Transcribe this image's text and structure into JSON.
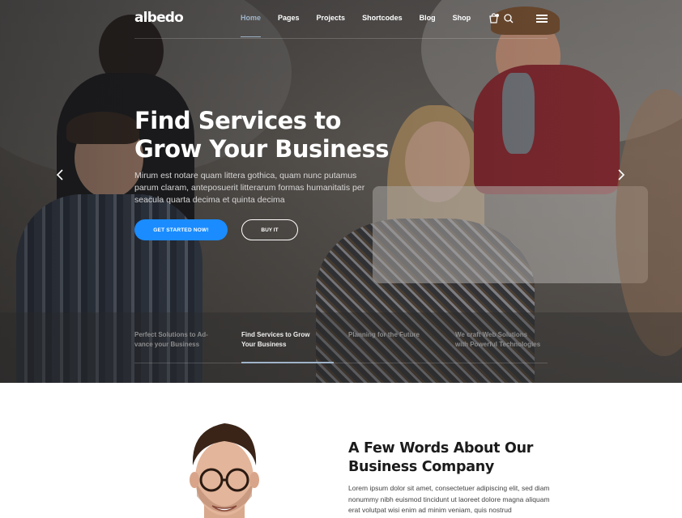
{
  "brand": {
    "logo": "albedo",
    "accent": "#1a8cff",
    "active_nav_color": "#9fb4c9"
  },
  "nav": {
    "items": [
      {
        "label": "Home",
        "active": true
      },
      {
        "label": "Pages",
        "active": false
      },
      {
        "label": "Projects",
        "active": false
      },
      {
        "label": "Shortcodes",
        "active": false
      },
      {
        "label": "Blog",
        "active": false
      },
      {
        "label": "Shop",
        "active": false
      }
    ],
    "icons": [
      "cart-icon",
      "search-icon",
      "hamburger-menu-icon"
    ]
  },
  "hero": {
    "title_line1": "Find Services to",
    "title_line2": "Grow Your Business",
    "text": "Mirum est notare quam littera gothica, quam nunc putamus parum claram, anteposuerit litterarum formas humanitatis per seacula quarta decima et quinta decima",
    "primary_button": "GET STARTED NOW!",
    "secondary_button": "BUY IT",
    "tabs": [
      {
        "line1": "Perfect Solutions to Ad-",
        "line2": "vance your Business",
        "active": false
      },
      {
        "line1": "Find Services to Grow",
        "line2": "Your Business",
        "active": true
      },
      {
        "line1": "Planning for the Future",
        "line2": "",
        "active": false
      },
      {
        "line1": "We craft Web Solutions",
        "line2": "with Powerful Technologies",
        "active": false
      }
    ]
  },
  "about": {
    "title_line1": "A Few Words About Our",
    "title_line2": "Business Company",
    "text": "Lorem ipsum dolor sit amet, consectetuer adipiscing elit, sed diam nonummy nibh euismod tincidunt ut laoreet dolore magna aliquam erat volutpat wisi enim ad minim veniam, quis nostrud"
  }
}
